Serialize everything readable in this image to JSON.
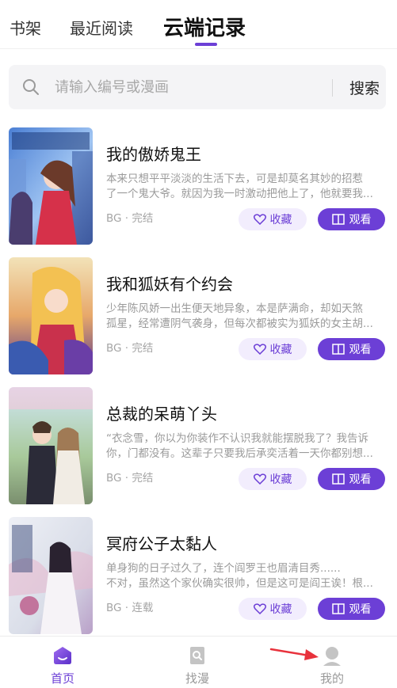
{
  "tabs": [
    {
      "label": "书架"
    },
    {
      "label": "最近阅读"
    },
    {
      "label": "云端记录"
    }
  ],
  "search": {
    "placeholder": "请输入编号或漫画",
    "button_label": "搜索"
  },
  "items": [
    {
      "title": "我的傲娇鬼王",
      "desc_line1": "本来只想平平淡淡的生活下去，可是却莫名其妙的招惹",
      "desc_line2": "了一个鬼大爷。就因为我一时激动把他上了，他就要我...",
      "meta": "BG · 完结",
      "fav_label": "收藏",
      "watch_label": "观看"
    },
    {
      "title": "我和狐妖有个约会",
      "desc_line1": "少年陈风娇一出生便天地异象，本是萨满命，却如天煞",
      "desc_line2": "孤星，经常遭阴气袭身，但每次都被实为狐妖的女主胡...",
      "meta": "BG · 完结",
      "fav_label": "收藏",
      "watch_label": "观看"
    },
    {
      "title": "总裁的呆萌丫头",
      "desc_line1": "“衣念雪，你以为你装作不认识我就能摆脱我了？我告诉",
      "desc_line2": "你，门都没有。这辈子只要我后承奕活着一天你都别想...",
      "meta": "BG · 完结",
      "fav_label": "收藏",
      "watch_label": "观看"
    },
    {
      "title": "冥府公子太黏人",
      "desc_line1": "单身狗的日子过久了，连个阎罗王也眉清目秀......",
      "desc_line2": "不对，虽然这个家伙确实很帅，但是这可是阎王诶！根...",
      "meta": "BG · 连载",
      "fav_label": "收藏",
      "watch_label": "观看"
    }
  ],
  "bottom_nav": [
    {
      "label": "首页",
      "icon": "home-icon"
    },
    {
      "label": "找漫",
      "icon": "find-comic-icon"
    },
    {
      "label": "我的",
      "icon": "profile-icon"
    }
  ],
  "colors": {
    "accent": "#6c3fd6",
    "accent_light": "#f2edfd",
    "muted_text": "#9a9a9a",
    "annotation_arrow": "#e8323c"
  }
}
